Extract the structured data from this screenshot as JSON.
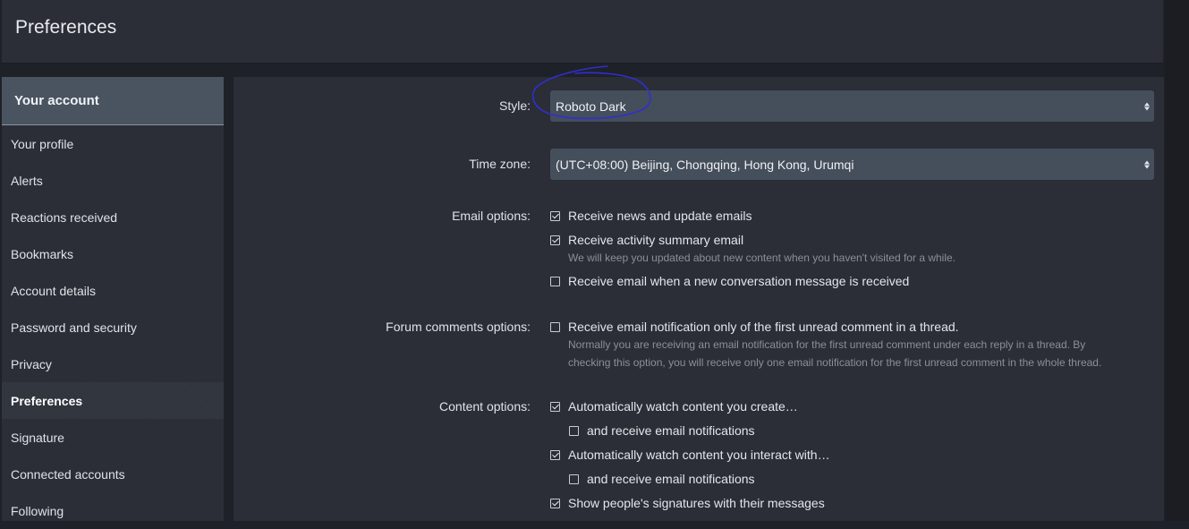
{
  "header": {
    "title": "Preferences"
  },
  "sidebar": {
    "section_title": "Your account",
    "items": [
      {
        "label": "Your profile"
      },
      {
        "label": "Alerts"
      },
      {
        "label": "Reactions received"
      },
      {
        "label": "Bookmarks"
      },
      {
        "label": "Account details"
      },
      {
        "label": "Password and security"
      },
      {
        "label": "Privacy"
      },
      {
        "label": "Preferences"
      },
      {
        "label": "Signature"
      },
      {
        "label": "Connected accounts"
      },
      {
        "label": "Following"
      }
    ],
    "active_item": "Preferences"
  },
  "form": {
    "style": {
      "label": "Style:",
      "value": "Roboto Dark"
    },
    "timezone": {
      "label": "Time zone:",
      "value": "(UTC+08:00) Beijing, Chongqing, Hong Kong, Urumqi"
    },
    "email_options": {
      "label": "Email options:",
      "news": {
        "label": "Receive news and update emails",
        "checked": true
      },
      "activity": {
        "label": "Receive activity summary email",
        "checked": true,
        "hint": "We will keep you updated about new content when you haven't visited for a while."
      },
      "conversation": {
        "label": "Receive email when a new conversation message is received",
        "checked": false
      }
    },
    "forum_comments": {
      "label": "Forum comments options:",
      "first_unread": {
        "label": "Receive email notification only of the first unread comment in a thread.",
        "checked": false
      },
      "hint_line1": "Normally you are receiving an email notification for the first unread comment under each reply in a thread. By",
      "hint_line2": "checking this option, you will receive only one email notification for the first unread comment in the whole thread."
    },
    "content_options": {
      "label": "Content options:",
      "watch_create": {
        "label": "Automatically watch content you create…",
        "checked": true
      },
      "watch_create_email": {
        "label": "and receive email notifications",
        "checked": false
      },
      "watch_interact": {
        "label": "Automatically watch content you interact with…",
        "checked": true
      },
      "watch_interact_email": {
        "label": "and receive email notifications",
        "checked": false
      },
      "signatures": {
        "label": "Show people's signatures with their messages",
        "checked": true
      }
    }
  },
  "colors": {
    "background": "#1f2128",
    "panel": "#2b2e37",
    "sidebar_header": "#4a5461",
    "select": "#454e5b",
    "annotation": "#2f2fd0"
  }
}
